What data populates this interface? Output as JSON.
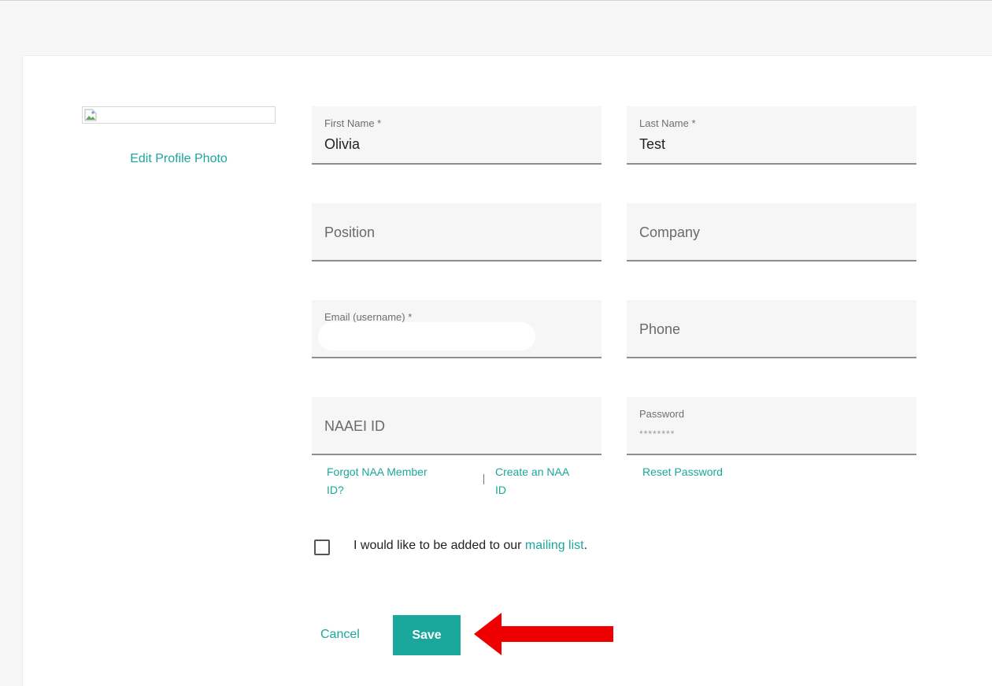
{
  "profile": {
    "edit_photo_label": "Edit Profile Photo"
  },
  "form": {
    "first_name": {
      "label": "First Name *",
      "value": "Olivia"
    },
    "last_name": {
      "label": "Last Name *",
      "value": "Test"
    },
    "position": {
      "placeholder": "Position"
    },
    "company": {
      "placeholder": "Company"
    },
    "email": {
      "label": "Email (username) *",
      "value": ""
    },
    "phone": {
      "placeholder": "Phone"
    },
    "naaei_id": {
      "placeholder": "NAAEI ID"
    },
    "password": {
      "label": "Password",
      "masked_value": "********"
    }
  },
  "links": {
    "forgot_line1": "Forgot NAA Member",
    "forgot_line2": "ID?",
    "separator": "|",
    "create_line1": "Create an NAA",
    "create_line2": "ID",
    "reset_password": "Reset Password"
  },
  "mailing": {
    "prefix": "I would like to be added to our ",
    "link": "mailing list",
    "suffix": ".",
    "checked": false
  },
  "actions": {
    "cancel_label": "Cancel",
    "save_label": "Save"
  },
  "colors": {
    "accent": "#1aa79c",
    "arrow": "#ee0000"
  }
}
